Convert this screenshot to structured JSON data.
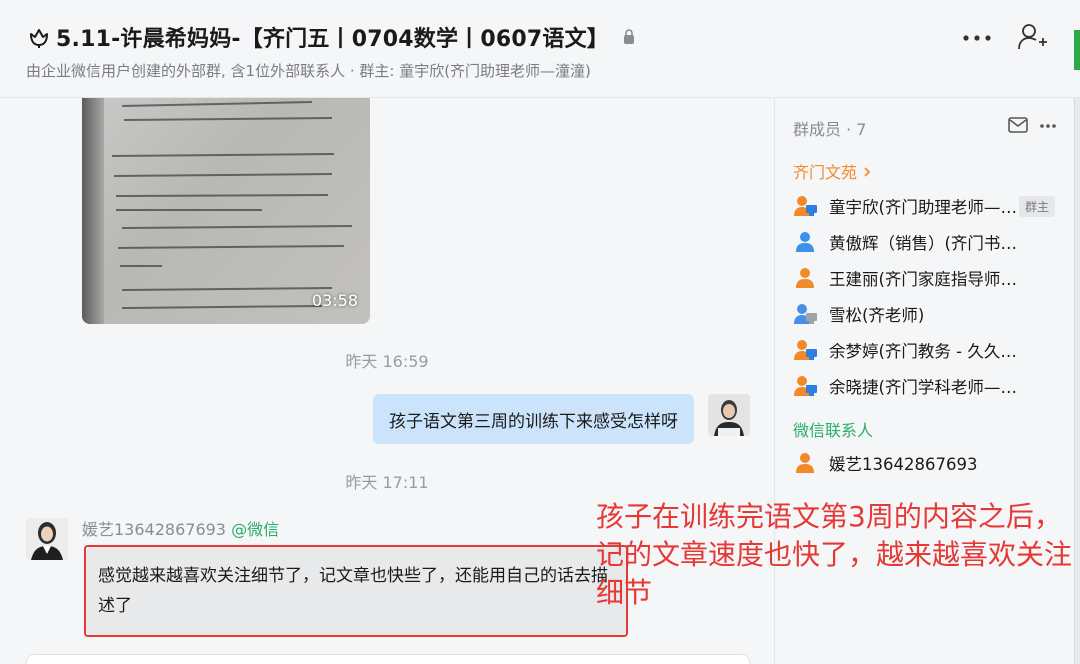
{
  "header": {
    "title": "5.11-许晨希妈妈-【齐门五丨0704数学丨0607语文】",
    "subtitle": "由企业微信用户创建的外部群, 含1位外部联系人 · 群主: 童宇欣(齐门助理老师—潼潼)"
  },
  "chat": {
    "video_duration": "03:58",
    "timestamp_1": "昨天 16:59",
    "outgoing_message": "孩子语文第三周的训练下来感受怎样呀",
    "timestamp_2": "昨天 17:11",
    "incoming_sender": "媛艺13642867693",
    "incoming_sender_tag": "@微信",
    "incoming_message": "感觉越来越喜欢关注细节了，记文章也快些了，还能用自己的话去描述了"
  },
  "members": {
    "header": "群成员 · 7",
    "section_company": "齐门文苑",
    "company_members": [
      {
        "name": "童宇欣(齐门助理老师—潼潼)",
        "icon": "user-monitor-icon",
        "badge": "群主"
      },
      {
        "name": "黄傲辉（销售）(齐门书院课程顾问)",
        "icon": "user-blue-icon"
      },
      {
        "name": "王建丽(齐门家庭指导师——王老师)",
        "icon": "user-orange-icon"
      },
      {
        "name": "雪松(齐老师)",
        "icon": "user-gray-monitor-icon"
      },
      {
        "name": "余梦婷(齐门教务 - 久久老师)",
        "icon": "user-monitor-icon"
      },
      {
        "name": "余晓捷(齐门学科老师——余老师)",
        "icon": "user-monitor-icon"
      }
    ],
    "section_wechat": "微信联系人",
    "wechat_members": [
      {
        "name": "媛艺13642867693",
        "icon": "user-orange-icon"
      }
    ]
  },
  "annotation": {
    "text": "孩子在训练完语文第3周的内容之后，记的文章速度也快了，越来越喜欢关注细节"
  },
  "colors": {
    "outgoing_bubble": "#cbe4fb",
    "incoming_bubble": "#e8e9eb",
    "annotation_red": "#e53935",
    "company_orange": "#f28a2a",
    "wechat_green": "#2aae67"
  }
}
